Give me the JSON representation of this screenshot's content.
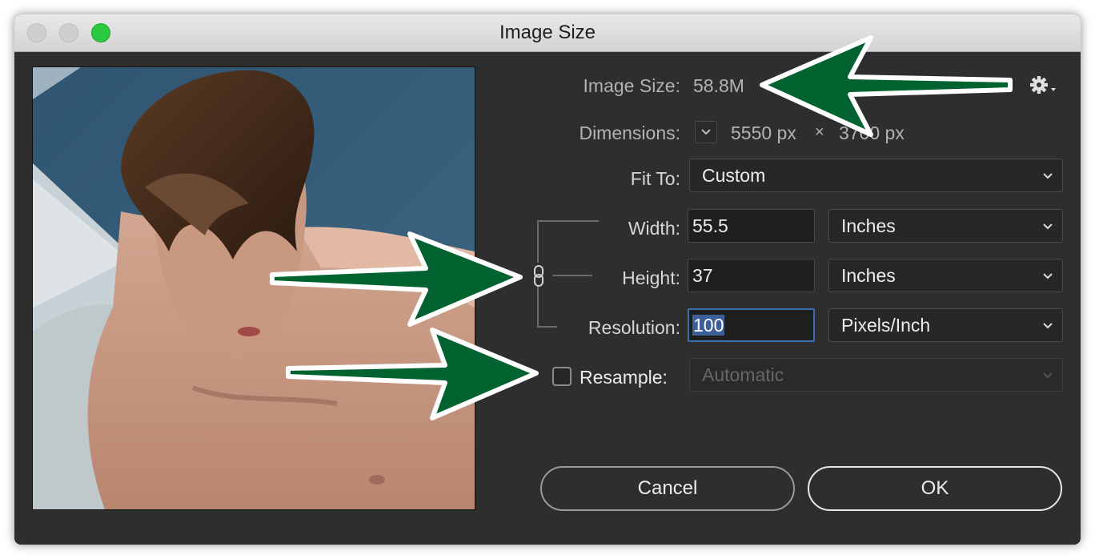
{
  "window": {
    "title": "Image Size"
  },
  "image_size": {
    "label": "Image Size:",
    "value": "58.8M"
  },
  "dimensions": {
    "label": "Dimensions:",
    "width": "5550 px",
    "times": "×",
    "height": "3700 px"
  },
  "fit_to": {
    "label": "Fit To:",
    "selected": "Custom"
  },
  "width": {
    "label": "Width:",
    "value": "55.5",
    "unit": "Inches"
  },
  "height": {
    "label": "Height:",
    "value": "37",
    "unit": "Inches"
  },
  "resolution": {
    "label": "Resolution:",
    "value": "100",
    "unit": "Pixels/Inch"
  },
  "resample": {
    "label": "Resample:",
    "checked": false,
    "selected": "Automatic"
  },
  "buttons": {
    "cancel": "Cancel",
    "ok": "OK"
  },
  "colors": {
    "arrow_fill": "#00622f",
    "arrow_stroke": "#ffffff",
    "zoom_button": "#2ac940",
    "focus_ring": "#3b6fb5"
  },
  "icons": [
    "gear-icon",
    "chevron-down-icon",
    "chain-link-icon"
  ]
}
